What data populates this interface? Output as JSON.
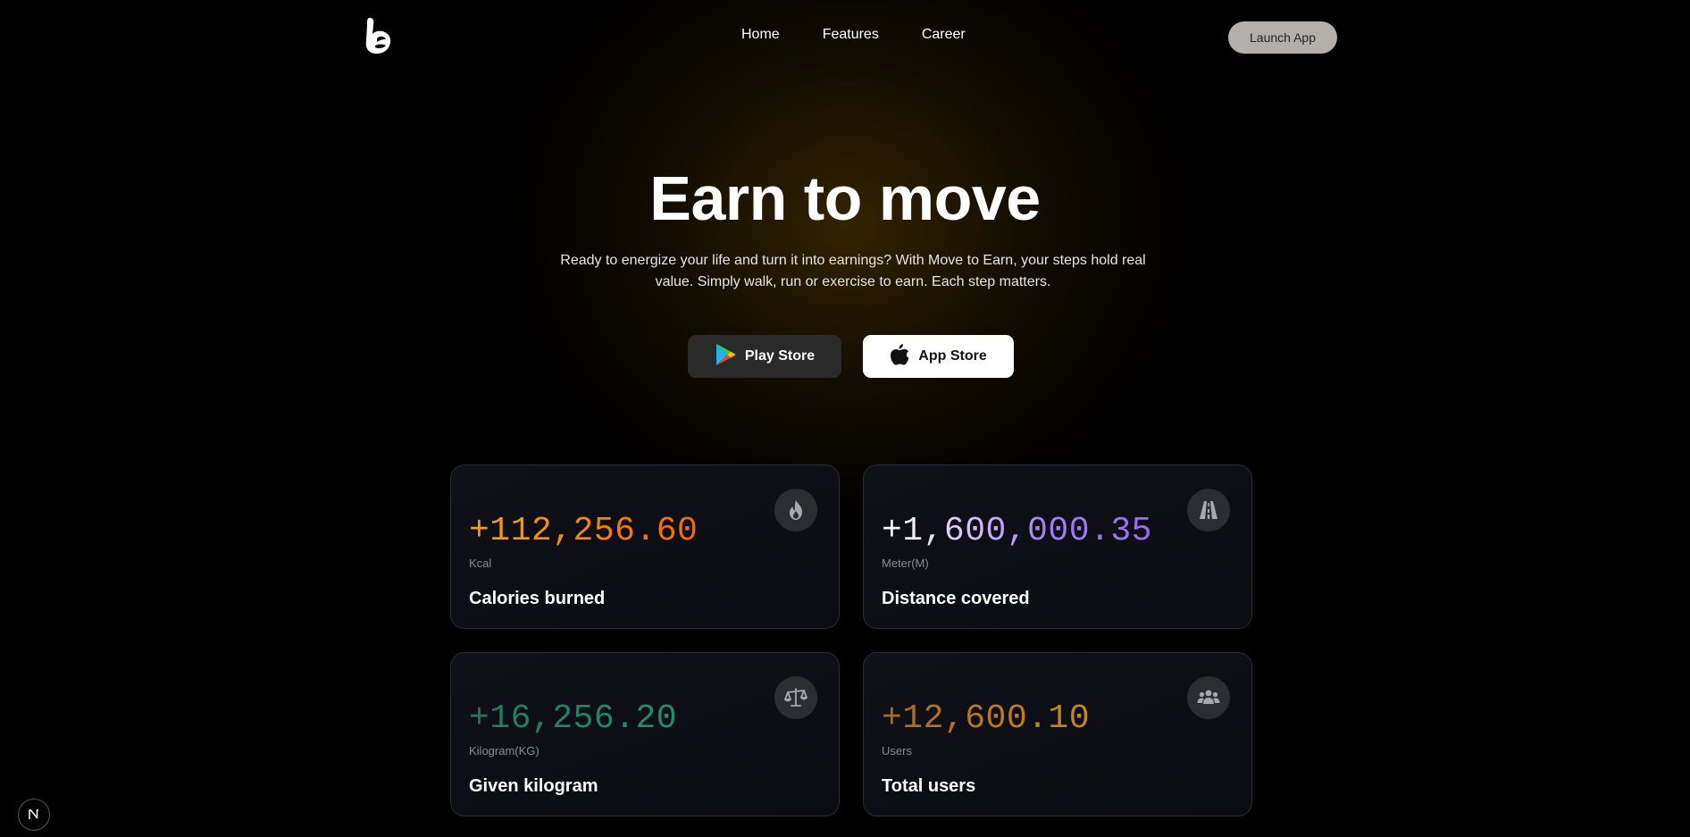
{
  "nav": {
    "logo_icon": "thumbs-up-b-logo-icon",
    "links": [
      {
        "label": "Home"
      },
      {
        "label": "Features"
      },
      {
        "label": "Career"
      }
    ],
    "launch_label": "Launch App"
  },
  "hero": {
    "title": "Earn to move",
    "subtitle": "Ready to energize your life and turn it into earnings? With Move to Earn, your steps hold real value. Simply walk, run or exercise to earn. Each step matters.",
    "play_store_label": "Play Store",
    "app_store_label": "App Store"
  },
  "stats": [
    {
      "value": "+112,256.60",
      "unit": "Kcal",
      "label": "Calories burned",
      "icon": "flame-icon",
      "color": "#f5a300"
    },
    {
      "value": "+1,600,000.35",
      "unit": "Meter(M)",
      "label": "Distance covered",
      "icon": "road-icon",
      "color": "#a37ef5"
    },
    {
      "value": "+16,256.20",
      "unit": "Kilogram(KG)",
      "label": "Given kilogram",
      "icon": "scale-icon",
      "color": "#1f8f6a"
    },
    {
      "value": "+12,600.10",
      "unit": "Users",
      "label": "Total users",
      "icon": "users-icon",
      "color": "#c8881e"
    }
  ],
  "framework_badge": "N"
}
